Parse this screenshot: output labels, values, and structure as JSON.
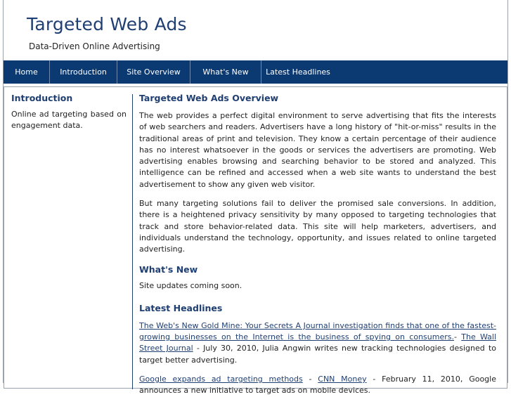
{
  "header": {
    "title": "Targeted Web Ads",
    "tagline": "Data-Driven Online Advertising"
  },
  "nav": {
    "items": [
      {
        "label": "Home"
      },
      {
        "label": "Introduction"
      },
      {
        "label": "Site Overview"
      },
      {
        "label": "What's New"
      },
      {
        "label": "Latest Headlines"
      }
    ]
  },
  "sidebar": {
    "heading": "Introduction",
    "text": "Online ad targeting based on engagement data."
  },
  "main": {
    "overview_heading": "Targeted Web Ads Overview",
    "paragraph1": "The web provides a perfect digital environment to serve advertising that fits the interests of web searchers and readers. Advertisers have a long history of \"hit-or-miss\" results in the traditional areas of print and television. They know a certain percentage of their audience has no interest whatsoever in the goods or services the advertisers are promoting. Web advertising enables browsing and searching behavior to be stored and analyzed. This intelligence can be refined and accessed when a web site wants to understand the best advertisement to show any given web visitor.",
    "paragraph2": "But many targeting solutions fail to deliver the promised sale conversions. In addition, there is a heightened privacy sensitivity by many opposed to targeting technologies that track and store behavior-related data. This site will help marketers, advertisers, and individuals understand the technology, opportunity, and issues related to online targeted advertising.",
    "whats_new_heading": "What's New",
    "whats_new_text": "Site updates coming soon.",
    "headlines_heading": "Latest Headlines",
    "headline1": {
      "link": "The Web's New Gold Mine: Your Secrets A Journal investigation finds that one of the fastest-growing businesses on the Internet is the business of spying on consumers.",
      "sep1": "- ",
      "source": "The Wall Street Journal",
      "text": " - July 30, 2010, Julia Angwin writes new tracking technologies designed to target better advertising."
    },
    "headline2": {
      "link": "Google expands ad targeting methods",
      "sep1": " - ",
      "source": "CNN Money",
      "text": " - February 11, 2010, Google announces a new initiative to target ads on mobile devices."
    }
  }
}
